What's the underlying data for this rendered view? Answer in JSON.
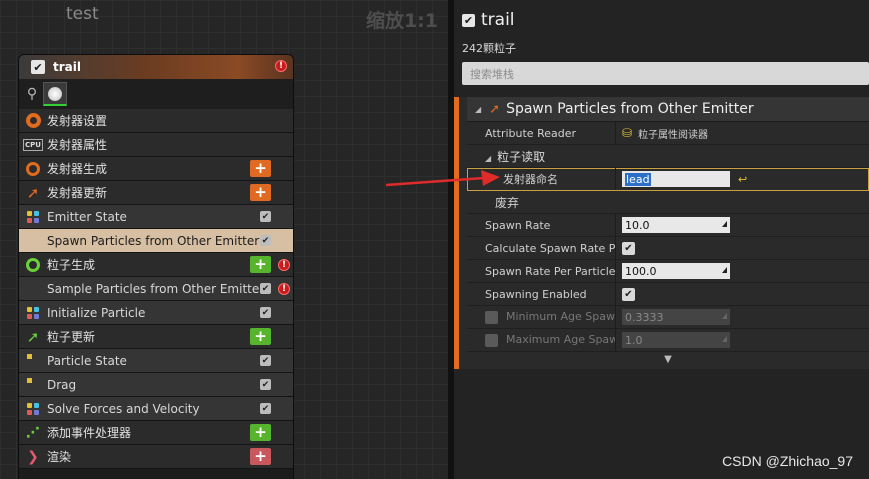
{
  "graph": {
    "title": "test",
    "zoom": "缩放1:1"
  },
  "node": {
    "title": "trail",
    "rows": [
      {
        "label": "发射器设置",
        "kind": "sec",
        "icon": "emitter-settings-icon"
      },
      {
        "label": "发射器属性",
        "kind": "sec",
        "icon": "cpu-icon",
        "icon_text": "CPU"
      },
      {
        "label": "发射器生成",
        "kind": "sec",
        "icon": "emitter-spawn-icon",
        "action": "add-orange"
      },
      {
        "label": "发射器更新",
        "kind": "sec",
        "icon": "emitter-update-icon",
        "action": "add-orange"
      },
      {
        "label": "Emitter State",
        "kind": "sub",
        "icon": "module-dots-icon",
        "checked": true
      },
      {
        "label": "Spawn Particles from Other Emitter",
        "kind": "sel",
        "checked": true
      },
      {
        "label": "粒子生成",
        "kind": "sec",
        "icon": "particle-spawn-icon",
        "action": "add-green",
        "error": true
      },
      {
        "label": "Sample Particles from Other Emitter",
        "kind": "sub",
        "checked": true,
        "error": true
      },
      {
        "label": "Initialize Particle",
        "kind": "sub",
        "icon": "module-dots-icon",
        "checked": true
      },
      {
        "label": "粒子更新",
        "kind": "sec",
        "icon": "particle-update-icon",
        "action": "add-green"
      },
      {
        "label": "Particle State",
        "kind": "sub",
        "icon": "module-dot-icon",
        "checked": true
      },
      {
        "label": "Drag",
        "kind": "sub",
        "icon": "module-dot-icon",
        "checked": true
      },
      {
        "label": "Solve Forces and Velocity",
        "kind": "sub",
        "icon": "module-dots-icon",
        "checked": true
      },
      {
        "label": "添加事件处理器",
        "kind": "sec",
        "icon": "event-handler-icon",
        "action": "add-green"
      },
      {
        "label": "渲染",
        "kind": "sec",
        "icon": "render-icon",
        "action": "add-red"
      }
    ],
    "icon_glyph": "+",
    "error_glyph": "!",
    "check_glyph": "✔"
  },
  "details": {
    "title": "trail",
    "particle_count": "242颗粒子",
    "search_placeholder": "搜索堆栈",
    "module_title": "Spawn Particles from Other Emitter",
    "props": [
      {
        "name": "Attribute Reader",
        "value": "粒子属性阅读器",
        "type": "asset"
      },
      {
        "name": "粒子读取",
        "type": "group"
      },
      {
        "name": "发射器命名",
        "value": "lead",
        "type": "text-selected"
      },
      {
        "name": "废弃",
        "type": "group2"
      },
      {
        "name": "Spawn Rate",
        "value": "10.0",
        "type": "number"
      },
      {
        "name": "Calculate Spawn Rate Pe",
        "type": "check"
      },
      {
        "name": "Spawn Rate Per Particle (",
        "value": "100.0",
        "type": "number"
      },
      {
        "name": "Spawning Enabled",
        "type": "check"
      },
      {
        "name": "Minimum Age Spawr",
        "value": "0.3333",
        "type": "number-disabled"
      },
      {
        "name": "Maximum Age Spaw",
        "value": "1.0",
        "type": "number-disabled"
      }
    ],
    "reset_glyph": "↩",
    "expand_glyph": "▼"
  },
  "watermark": "CSDN @Zhichao_97",
  "colors": {
    "accent_orange": "#e16b1e",
    "arrow_red": "#e02b2b",
    "selection_tan": "#d6bfa2",
    "highlight_gold": "#c9a13d"
  }
}
